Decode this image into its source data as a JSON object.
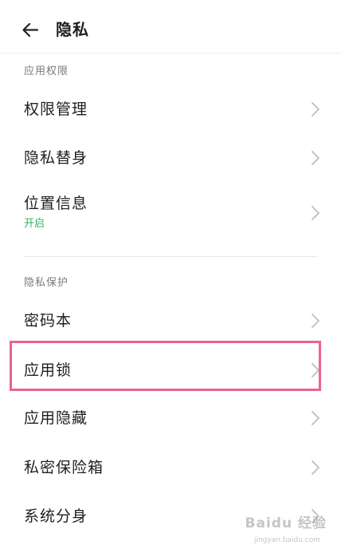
{
  "header": {
    "title": "隐私"
  },
  "sections": [
    {
      "title": "应用权限",
      "items": [
        {
          "label": "权限管理"
        },
        {
          "label": "隐私替身"
        },
        {
          "label": "位置信息",
          "sub": "开启"
        }
      ]
    },
    {
      "title": "隐私保护",
      "items": [
        {
          "label": "密码本"
        },
        {
          "label": "应用锁"
        },
        {
          "label": "应用隐藏"
        },
        {
          "label": "私密保险箱"
        },
        {
          "label": "系统分身"
        }
      ]
    }
  ],
  "colors": {
    "status_on": "#2fb36a",
    "highlight": "#e8648f"
  },
  "icons": {
    "back": "arrow-left-icon",
    "row_arrow": "chevron-right-icon"
  },
  "watermark": {
    "text": "Baidu 经验",
    "sub": "jingyan.baidu.com"
  }
}
